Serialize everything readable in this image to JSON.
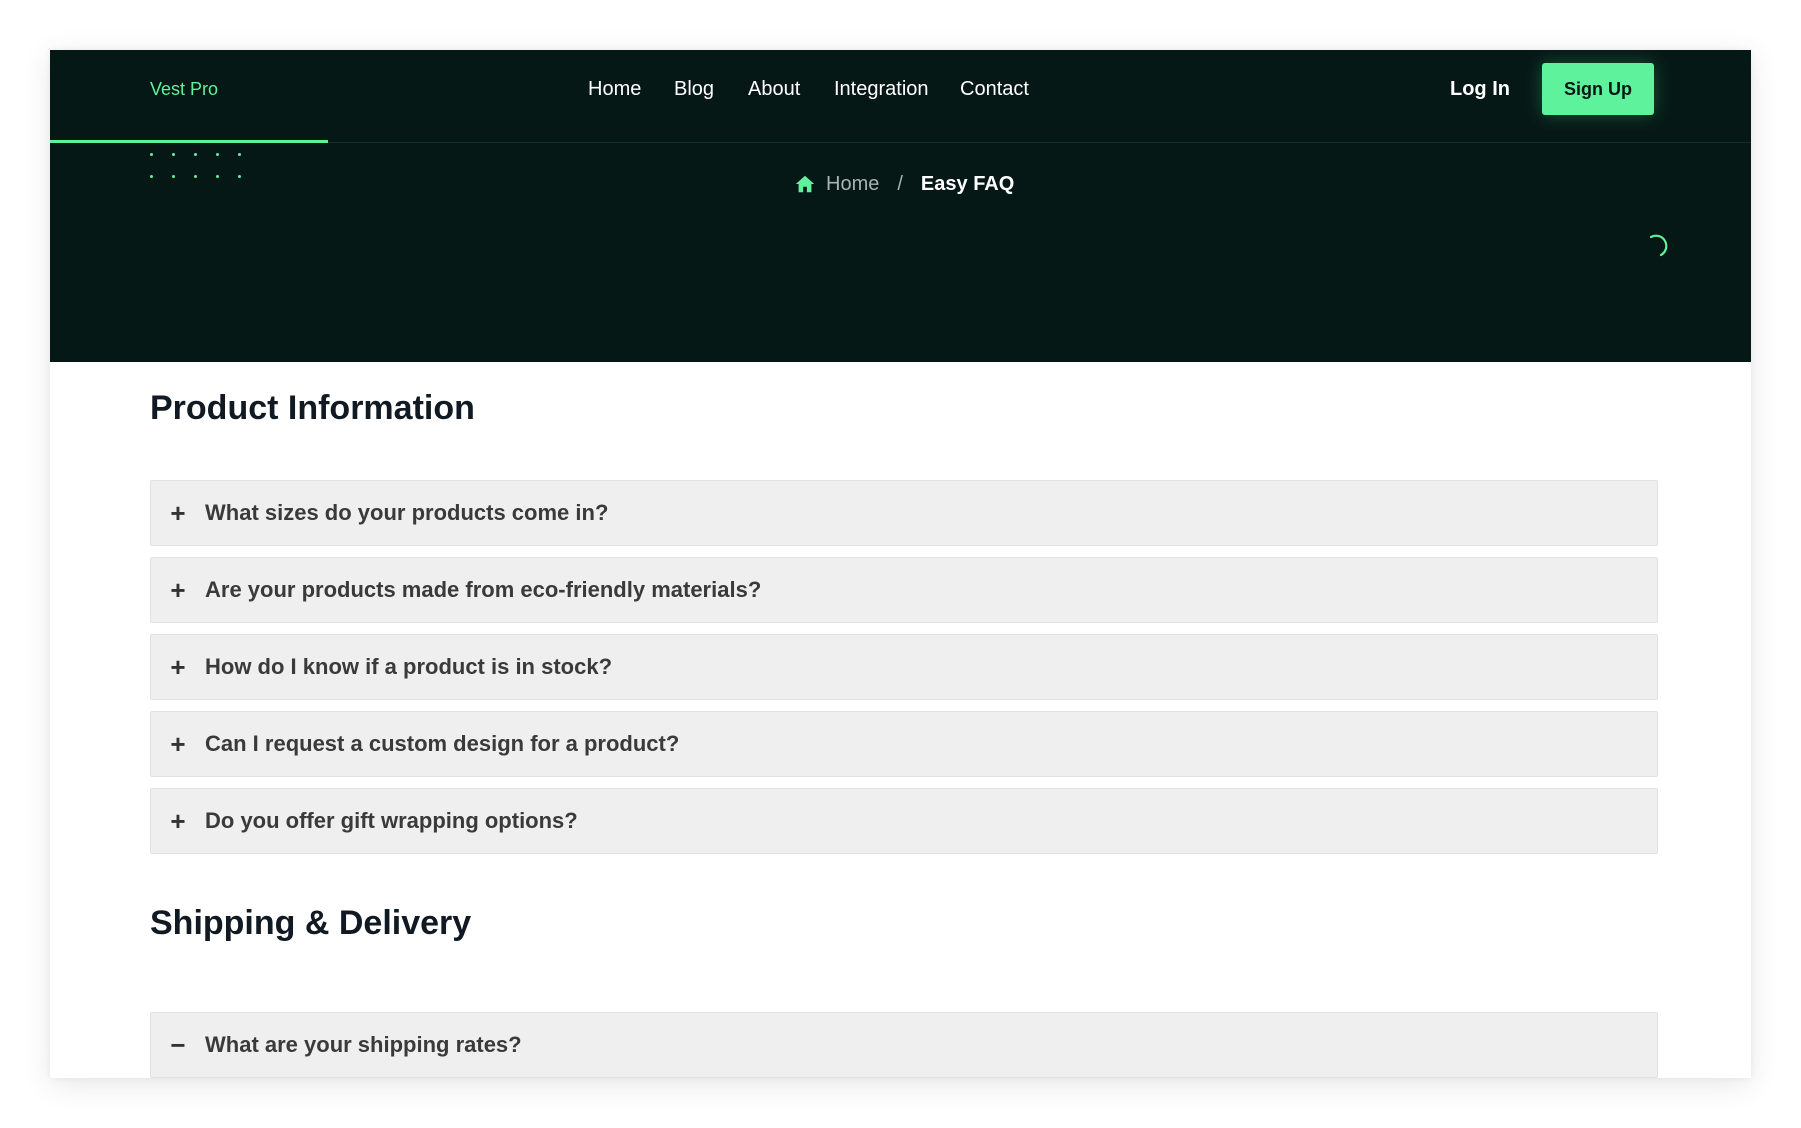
{
  "brand": {
    "logo_text": "Vest Pro",
    "accent": "#5ff29c",
    "dark_bg": "#061815"
  },
  "nav": {
    "links": [
      "Home",
      "Blog",
      "About",
      "Integration",
      "Contact"
    ],
    "login_label": "Log In",
    "signup_label": "Sign Up"
  },
  "breadcrumb": {
    "icon": "home-icon",
    "home": "Home",
    "separator": "/",
    "current": "Easy FAQ"
  },
  "sections": [
    {
      "title": "Product Information",
      "items": [
        {
          "question": "What sizes do your products come in?",
          "expanded": false,
          "toggle": "+"
        },
        {
          "question": "Are your products made from eco-friendly materials?",
          "expanded": false,
          "toggle": "+"
        },
        {
          "question": "How do I know if a product is in stock?",
          "expanded": false,
          "toggle": "+"
        },
        {
          "question": "Can I request a custom design for a product?",
          "expanded": false,
          "toggle": "+"
        },
        {
          "question": "Do you offer gift wrapping options?",
          "expanded": false,
          "toggle": "+"
        }
      ]
    },
    {
      "title": "Shipping & Delivery",
      "items": [
        {
          "question": "What are your shipping rates?",
          "expanded": true,
          "toggle": "−"
        }
      ]
    }
  ]
}
